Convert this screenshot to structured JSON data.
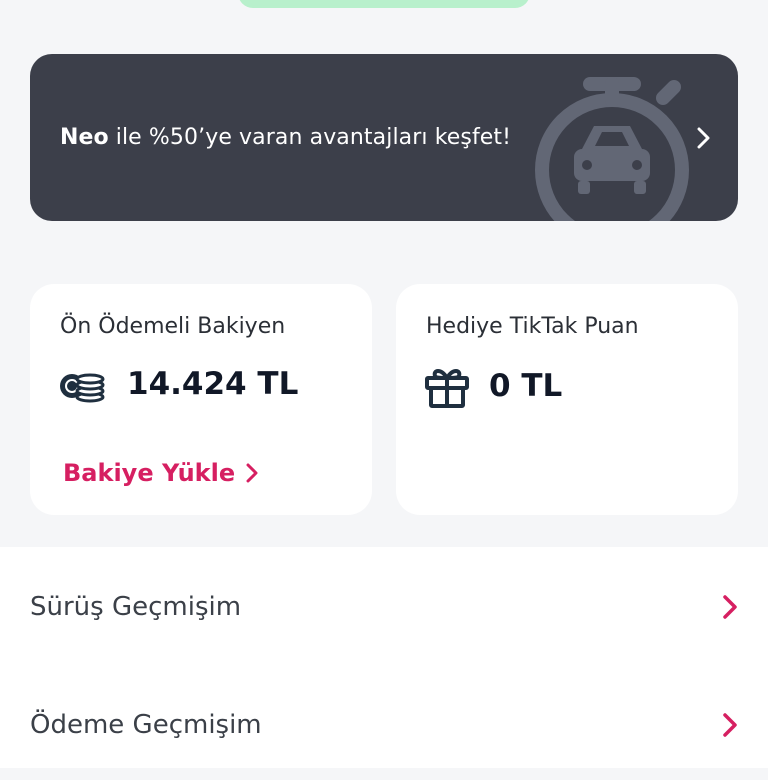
{
  "promo": {
    "brand": "Neo",
    "text": "ile %50’ye varan avantajları keşfet!",
    "art_icon": "stopwatch-car-icon",
    "chevron_icon": "chevron-right-icon"
  },
  "cards": {
    "prepaid": {
      "title": "Ön Ödemeli Bakiyen",
      "icon": "coins-icon",
      "value": "14.424 TL",
      "link_label": "Bakiye Yükle",
      "link_icon": "chevron-right-icon"
    },
    "gift": {
      "title": "Hediye TikTak Puan",
      "icon": "gift-icon",
      "value": "0 TL"
    }
  },
  "menu": {
    "items": [
      {
        "label": "Sürüş Geçmişim",
        "icon": "chevron-right-icon"
      },
      {
        "label": "Ödeme Geçmişim",
        "icon": "chevron-right-icon"
      }
    ]
  },
  "colors": {
    "accent": "#d61f61",
    "promo_bg": "#3c3f4a",
    "top_pill": "#b8f0cc",
    "page_bg": "#f5f6f8"
  }
}
